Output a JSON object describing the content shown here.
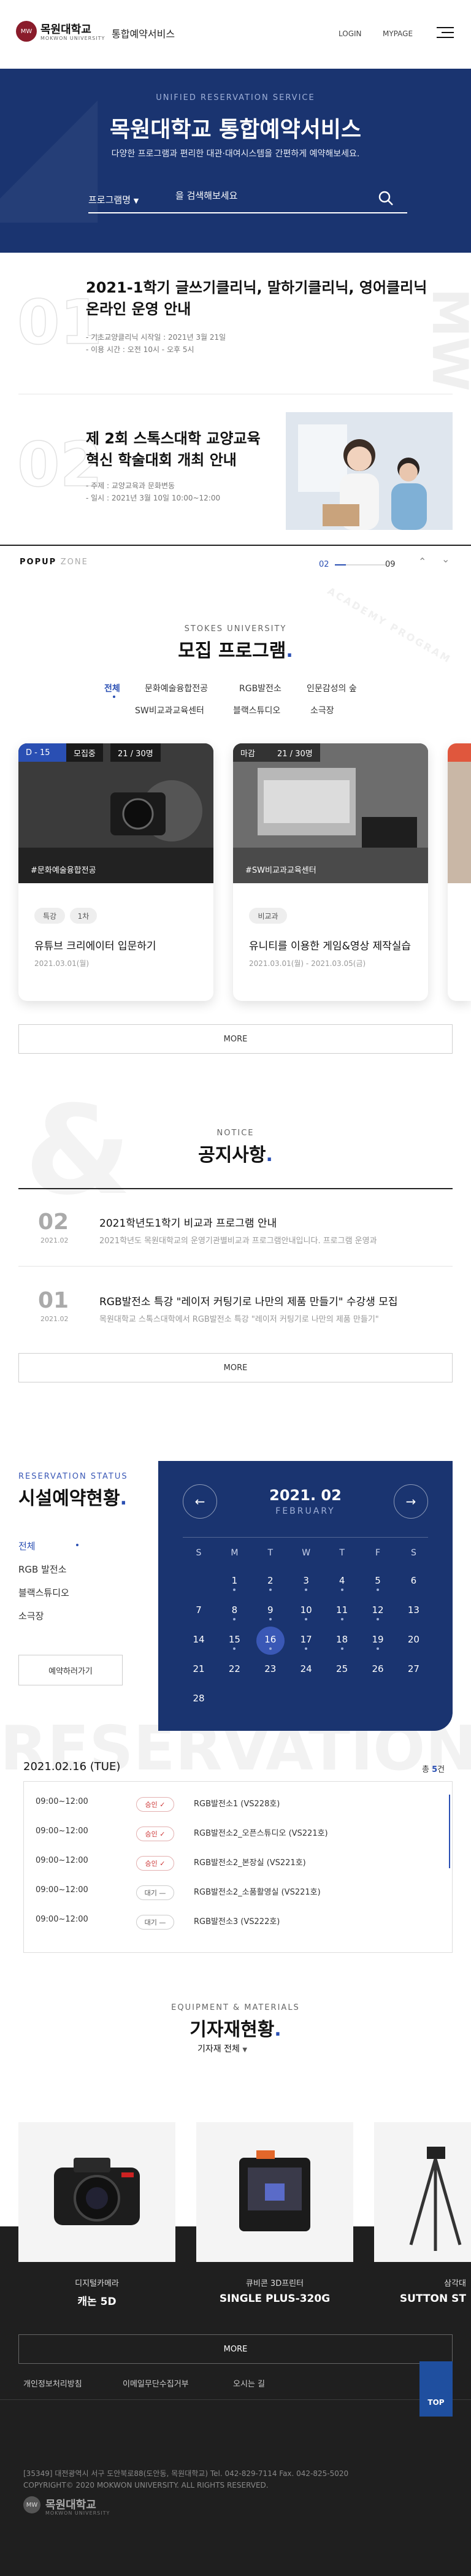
{
  "header": {
    "logo_emblem": "MW",
    "logo_ko": "목원대학교",
    "logo_en": "MOKWON UNIVERSITY",
    "service": "통합예약서비스",
    "login": "LOGIN",
    "mypage": "MYPAGE"
  },
  "hero": {
    "subtitle": "UNIFIED RESERVATION SERVICE",
    "title": "목원대학교 통합예약서비스",
    "desc": "다양한 프로그램과 편리한 대관·대여시스템을 간편하게 예약해보세요.",
    "select": "프로그램명",
    "placeholder": "을 검색해보세요"
  },
  "popups": [
    {
      "num": "01",
      "title": [
        "2021-1학기 글쓰기클리닉, 말하기클리닉, 영어클리닉",
        "온라인 운영 안내"
      ],
      "info": [
        "- 기초교양클리닉 시작일 : 2021년 3월 21일",
        "- 이용 시간 : 오전 10시 - 오후 5시"
      ]
    },
    {
      "num": "02",
      "title": [
        "제 2회 스톡스대학 교양교육",
        "혁신 학술대회 개최 안내"
      ],
      "info": [
        "- 주제 : 교양교육과 문화변동",
        "- 일시 : 2021년 3월 10일 10:00~12:00"
      ]
    }
  ],
  "popup_zone": {
    "label": "POPUP",
    "label2": "ZONE",
    "current": "02",
    "total": "09",
    "progress": 0.22
  },
  "recruit": {
    "sub": "STOKES UNIVERSITY",
    "title": "모집 프로그램",
    "tabs": [
      "전체",
      "문화예술융합전공",
      "RGB발전소",
      "인문감성의 숲",
      "SW비교과교육센터",
      "블랙스튜디오",
      "소극장"
    ],
    "cards": [
      {
        "badge": "D - 15",
        "badge_color": "#2a4fb3",
        "status": "모집중",
        "count": "21 / 30명",
        "cap": "#문화예술융합전공",
        "tags": [
          "특강",
          "1차"
        ],
        "title": "유튜브 크리에이터 입문하기",
        "date": "2021.03.01(월)"
      },
      {
        "badge": "마감",
        "badge_color": "#333333",
        "status": "",
        "count": "21 / 30명",
        "cap": "#SW비교과교육센터",
        "tags": [
          "비교과"
        ],
        "title": "유니티를 이용한 게임&영상 제작실습",
        "date": "2021.03.01(월) - 2021.03.05(금)"
      }
    ],
    "more": "MORE"
  },
  "notice": {
    "sub": "NOTICE",
    "title": "공지사항",
    "items": [
      {
        "num": "02",
        "date": "2021.02",
        "title": "2021학년도1학기 비교과 프로그램 안내",
        "desc": "2021학년도 목원대학교의 운영기관별비교과 프로그램안내입니다. 프로그램 운영과"
      },
      {
        "num": "01",
        "date": "2021.02",
        "title": "RGB발전소 특강 \"레이저 커팅기로 나만의 제품 만들기\" 수강생 모집",
        "desc": "목원대학교 스톡스대학에서 RGB발전소 특강 \"레이저 커팅기로 나만의 제품 만들기\""
      }
    ],
    "more": "MORE"
  },
  "facility": {
    "sub": "RESERVATION STATUS",
    "title": "시설예약현황",
    "items": [
      "전체",
      "RGB 발전소",
      "블랙스튜디오",
      "소극장"
    ],
    "button": "예약하러가기",
    "cal_year": "2021. 02",
    "cal_month": "FEBRUARY",
    "weekdays": [
      "S",
      "M",
      "T",
      "W",
      "T",
      "F",
      "S"
    ],
    "weeks": [
      [
        "",
        "1",
        "2",
        "3",
        "4",
        "5",
        "6"
      ],
      [
        "7",
        "8",
        "9",
        "10",
        "11",
        "12",
        "13"
      ],
      [
        "14",
        "15",
        "16",
        "17",
        "18",
        "19",
        "20"
      ],
      [
        "21",
        "22",
        "23",
        "24",
        "25",
        "26",
        "27"
      ],
      [
        "28",
        "",
        "",
        "",
        "",
        "",
        ""
      ]
    ],
    "dots": [
      "1",
      "2",
      "3",
      "4",
      "5",
      "8",
      "9",
      "10",
      "11",
      "12",
      "15",
      "16",
      "17",
      "18",
      "19"
    ],
    "selected": "16",
    "bg_word": "RESERVATION",
    "res_date": "2021.02.16 (TUE)",
    "total_label": "총",
    "total": "5",
    "total_unit": "건",
    "rows": [
      {
        "time": "09:00~12:00",
        "status": "승인",
        "ok": true,
        "room": "RGB발전소1 (VS228호)"
      },
      {
        "time": "09:00~12:00",
        "status": "승인",
        "ok": true,
        "room": "RGB발전소2_오픈스튜디오 (VS221호)"
      },
      {
        "time": "09:00~12:00",
        "status": "승인",
        "ok": true,
        "room": "RGB발전소2_본장실 (VS221호)"
      },
      {
        "time": "09:00~12:00",
        "status": "대기",
        "ok": false,
        "room": "RGB발전소2_소품활영실 (VS221호)"
      },
      {
        "time": "09:00~12:00",
        "status": "대기",
        "ok": false,
        "room": "RGB발전소3 (VS222호)"
      }
    ]
  },
  "equipment": {
    "sub": "EQUIPMENT & MATERIALS",
    "title": "기자재현황",
    "filter": "기자재 전체",
    "items": [
      {
        "cat": "디지털카메라",
        "name": "캐논 5D"
      },
      {
        "cat": "큐비콘 3D프린터",
        "name": "SINGLE PLUS-320G"
      },
      {
        "cat": "삼각대",
        "name": "SUTTON ST"
      }
    ],
    "more": "MORE"
  },
  "footer": {
    "links": [
      "개인정보처리방침",
      "이메일무단수집거부",
      "오시는 길"
    ],
    "top": "TOP",
    "addr": "[35349] 대전광역시 서구 도안북로88(도안동, 목원대학교)   Tel. 042-829-7114   Fax. 042-825-5020",
    "copy": "COPYRIGHT© 2020 MOKWON UNIVERSITY. ALL RIGHTS RESERVED.",
    "logo_ko": "목원대학교",
    "logo_en": "MOKWON UNIVERSITY"
  }
}
